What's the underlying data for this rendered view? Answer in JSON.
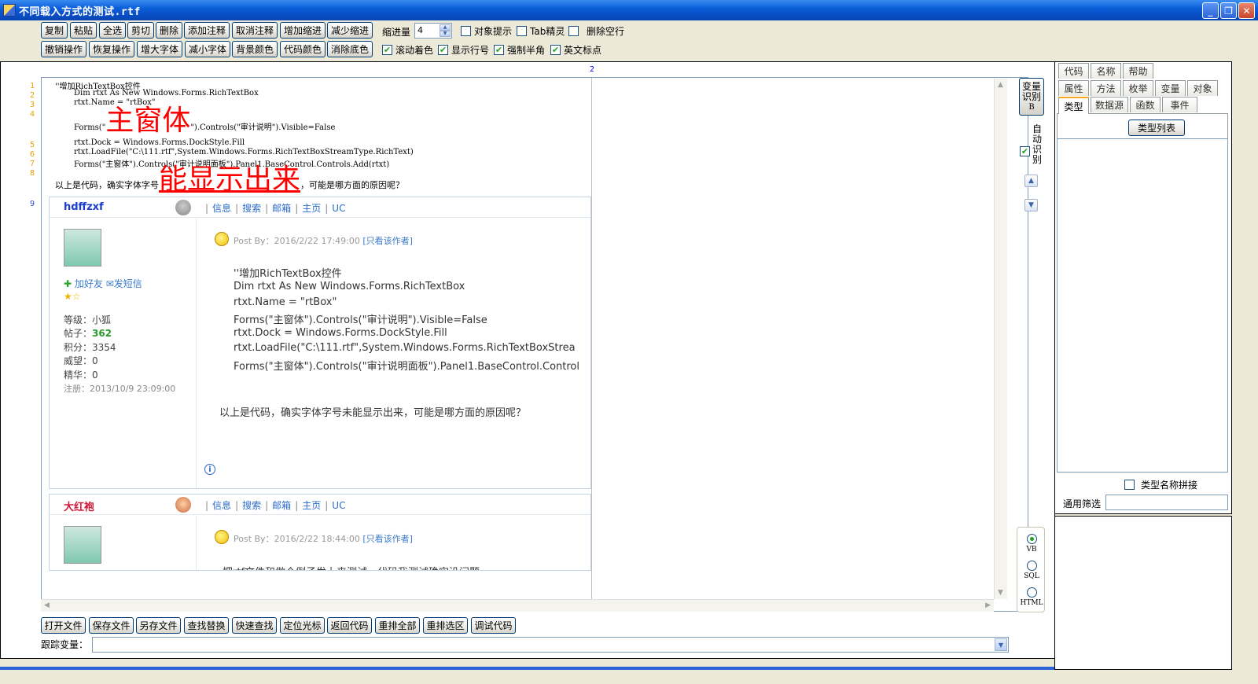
{
  "window": {
    "title": "不同载入方式的测试.rtf",
    "min": "_",
    "max": "❐",
    "close": "✕"
  },
  "toolbar": {
    "row1": [
      "复制",
      "粘贴",
      "全选",
      "剪切",
      "删除",
      "添加注释",
      "取消注释",
      "增加缩进",
      "减少缩进"
    ],
    "row2": [
      "撤销操作",
      "恢复操作",
      "增大字体",
      "减小字体",
      "背景颜色",
      "代码颜色",
      "消除底色"
    ],
    "indent_label": "缩进量",
    "indent_value": "4",
    "options": [
      {
        "label": "对象提示",
        "checked": false
      },
      {
        "label": "Tab精灵",
        "checked": false
      },
      {
        "label": "删除空行",
        "checked": false
      },
      {
        "label": "滚动着色",
        "checked": true
      },
      {
        "label": "显示行号",
        "checked": true
      },
      {
        "label": "强制半角",
        "checked": true
      },
      {
        "label": "英文标点",
        "checked": true
      }
    ]
  },
  "editor": {
    "column_marker": "2",
    "line_numbers": [
      "1",
      "2",
      "3",
      "4",
      "5",
      "6",
      "7",
      "8",
      "9"
    ],
    "code": {
      "l1": "''增加RichTextBox控件",
      "l2": "Dim rtxt As New Windows.Forms.RichTextBox",
      "l3": "rtxt.Name = \"rtBox\"",
      "l4a": "Forms(\"",
      "l4big": "主窗体",
      "l4b": "\").Controls(\"审计说明\").Visible=False",
      "l5": "rtxt.Dock = Windows.Forms.DockStyle.Fill",
      "l6": "rtxt.LoadFile(\"C:\\111.rtf\",System.Windows.Forms.RichTextBoxStreamType.RichText)",
      "l7": "Forms(\"主窗体\").Controls(\"审计说明面板\").Panel1.BaseControl.Controls.Add(rtxt)",
      "l8a": "以上是代码，确实字体字号",
      "l8big": "能显示出来",
      "l8b": "，可能是哪方面的原因呢？"
    },
    "nav_links": [
      "信息",
      "搜索",
      "邮箱",
      "主页",
      "UC"
    ],
    "post1": {
      "user": "hdffzxf",
      "add_friend": "加好友",
      "send_msg": "发短信",
      "stats": {
        "level": "等级：小狐",
        "posts_label": "帖子：",
        "posts_value": "362",
        "points": "积分：3354",
        "prestige": "威望：0",
        "essence": "精华：0",
        "registered": "注册：2013/10/9 23:09:00"
      },
      "meta": "Post By：2016/2/22 17:49:00",
      "only_author": "[只看该作者]",
      "lines": [
        "''增加RichTextBox控件",
        "Dim rtxt As New Windows.Forms.RichTextBox",
        "rtxt.Name = \"rtBox\"",
        "Forms(\"主窗体\").Controls(\"审计说明\").Visible=False",
        "rtxt.Dock = Windows.Forms.DockStyle.Fill",
        "rtxt.LoadFile(\"C:\\111.rtf\",System.Windows.Forms.RichTextBoxStrea",
        "Forms(\"主窗体\").Controls(\"审计说明面板\").Panel1.BaseControl.Control"
      ],
      "question": "以上是代码，确实字体字号未能显示出来，可能是哪方面的原因呢？",
      "info_icon": "i"
    },
    "post2": {
      "user": "大红袍",
      "meta": "Post By：2016/2/22 18:44:00",
      "only_author": "[只看该作者]",
      "partial": "把rtf文件和做个例子发上来测试，代码我测试确实没问题"
    }
  },
  "side_buttons": {
    "recognize": [
      "变量",
      "识别",
      "B"
    ],
    "auto_label": [
      "自",
      "动",
      "识",
      "别"
    ],
    "auto_checked": true,
    "radios": [
      {
        "label": "VB",
        "checked": true
      },
      {
        "label": "SQL",
        "checked": false
      },
      {
        "label": "HTML",
        "checked": false
      }
    ]
  },
  "bottom": {
    "buttons": [
      "打开文件",
      "保存文件",
      "另存文件",
      "查找替换",
      "快速查找",
      "定位光标",
      "返回代码",
      "重排全部",
      "重排选区",
      "调试代码"
    ],
    "track_label": "跟踪变量："
  },
  "right_panel": {
    "tabs_row1": [
      "代码",
      "名称",
      "帮助"
    ],
    "tabs_row2": [
      "属性",
      "方法",
      "枚举",
      "变量",
      "对象"
    ],
    "tabs_row3": [
      "类型",
      "数据源",
      "函数",
      "事件"
    ],
    "active_tab": "类型",
    "type_list_button": "类型列表",
    "concat_label": "类型名称拼接",
    "filter_label": "通用筛选"
  }
}
